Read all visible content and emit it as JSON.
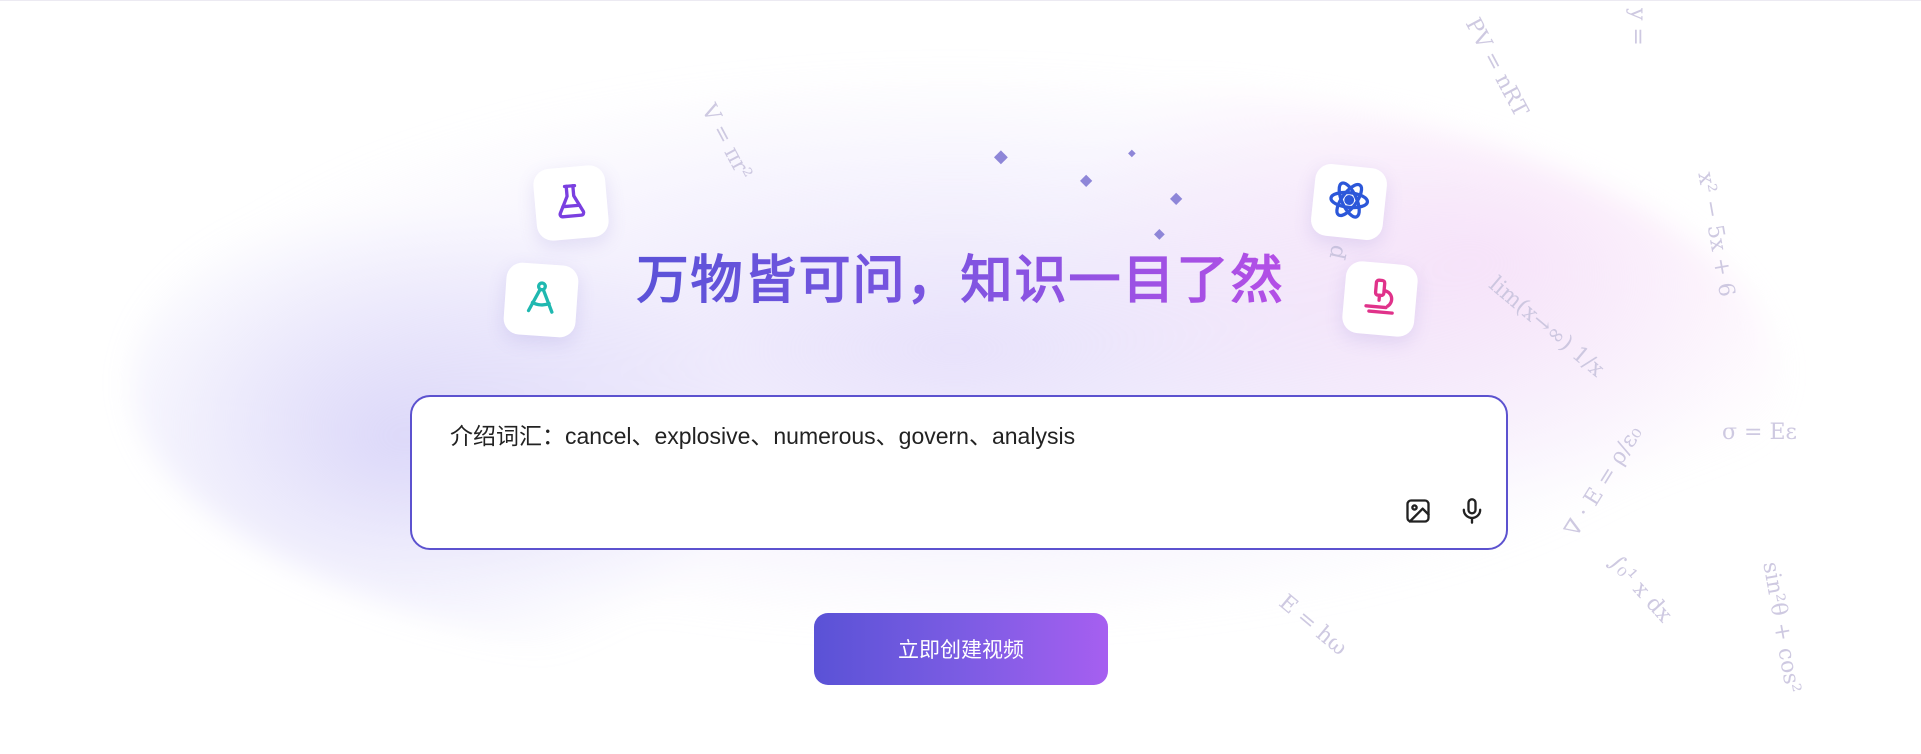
{
  "hero": {
    "headline": "万物皆可问，知识一目了然"
  },
  "prompt": {
    "text": "介绍词汇：cancel、explosive、numerous、govern、analysis",
    "image_button_icon": "image-icon",
    "mic_button_icon": "microphone-icon"
  },
  "cta": {
    "label": "立即创建视频"
  },
  "decor": {
    "icons": [
      "flask-icon",
      "compass-icon",
      "atom-icon",
      "microscope-icon"
    ],
    "formulas": {
      "f1": "V = πr²",
      "f2": "PV = nRT",
      "f3": "y =",
      "f4": "x² − 5x + 6",
      "f5": "lim(x→∞) 1/x",
      "f6": "σ = Eε",
      "f7": "∇ · E = ρ/ε₀",
      "f8": "E = hω",
      "f9": "∫₀¹ x dx",
      "f10": "sin²θ + cos²",
      "f11": "p = mv"
    },
    "colors": {
      "accent_start": "#5a52d6",
      "accent_end": "#a65ff0",
      "border": "#5c52cf"
    }
  }
}
